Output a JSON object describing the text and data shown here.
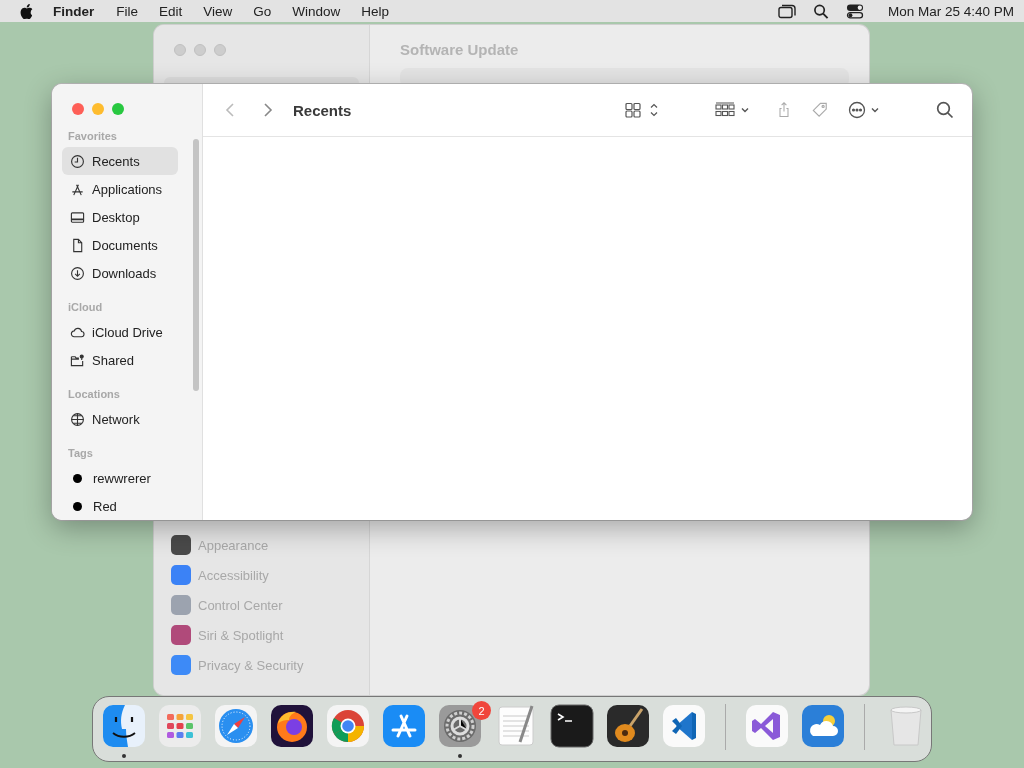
{
  "menu_bar": {
    "app_name": "Finder",
    "menus": [
      "File",
      "Edit",
      "View",
      "Go",
      "Window",
      "Help"
    ],
    "clock": "Mon Mar 25  4:40 PM"
  },
  "settings_window": {
    "title": "Software Update",
    "sidebar_items": [
      {
        "label": "Appearance",
        "color": "#4a4a4a"
      },
      {
        "label": "Accessibility",
        "color": "#3b82f6"
      },
      {
        "label": "Control Center",
        "color": "#9ca3af"
      },
      {
        "label": "Siri & Spotlight",
        "color": "#b04a7a"
      },
      {
        "label": "Privacy & Security",
        "color": "#3d8af7"
      }
    ]
  },
  "finder_window": {
    "title": "Recents",
    "sidebar": [
      {
        "header": "Favorites",
        "items": [
          {
            "label": "Recents",
            "kind": "clock",
            "selected": true
          },
          {
            "label": "Applications",
            "kind": "apps",
            "selected": false
          },
          {
            "label": "Desktop",
            "kind": "desktop",
            "selected": false
          },
          {
            "label": "Documents",
            "kind": "document",
            "selected": false
          },
          {
            "label": "Downloads",
            "kind": "download",
            "selected": false
          }
        ]
      },
      {
        "header": "iCloud",
        "items": [
          {
            "label": "iCloud Drive",
            "kind": "cloud",
            "selected": false
          },
          {
            "label": "Shared",
            "kind": "shared",
            "selected": false
          }
        ]
      },
      {
        "header": "Locations",
        "items": [
          {
            "label": "Network",
            "kind": "globe",
            "selected": false
          }
        ]
      },
      {
        "header": "Tags",
        "items": [
          {
            "label": "rewwrerer",
            "kind": "tag",
            "color": "#000000",
            "selected": false
          },
          {
            "label": "Red",
            "kind": "tag",
            "color": "#000000",
            "selected": false
          }
        ]
      }
    ]
  },
  "dock": [
    {
      "kind": "finder",
      "running": true
    },
    {
      "kind": "launchpad",
      "running": false
    },
    {
      "kind": "safari",
      "running": false
    },
    {
      "kind": "firefox",
      "running": false
    },
    {
      "kind": "chrome",
      "running": false
    },
    {
      "kind": "appstore",
      "running": false
    },
    {
      "kind": "settings",
      "running": true,
      "badge": "2"
    },
    {
      "kind": "textedit",
      "running": false
    },
    {
      "kind": "terminal",
      "running": false
    },
    {
      "kind": "garageband",
      "running": false
    },
    {
      "kind": "vscode",
      "running": false
    },
    {
      "kind": "separator"
    },
    {
      "kind": "visualstudio",
      "running": false
    },
    {
      "kind": "weather",
      "running": false
    },
    {
      "kind": "separator"
    },
    {
      "kind": "trash",
      "running": false
    }
  ]
}
